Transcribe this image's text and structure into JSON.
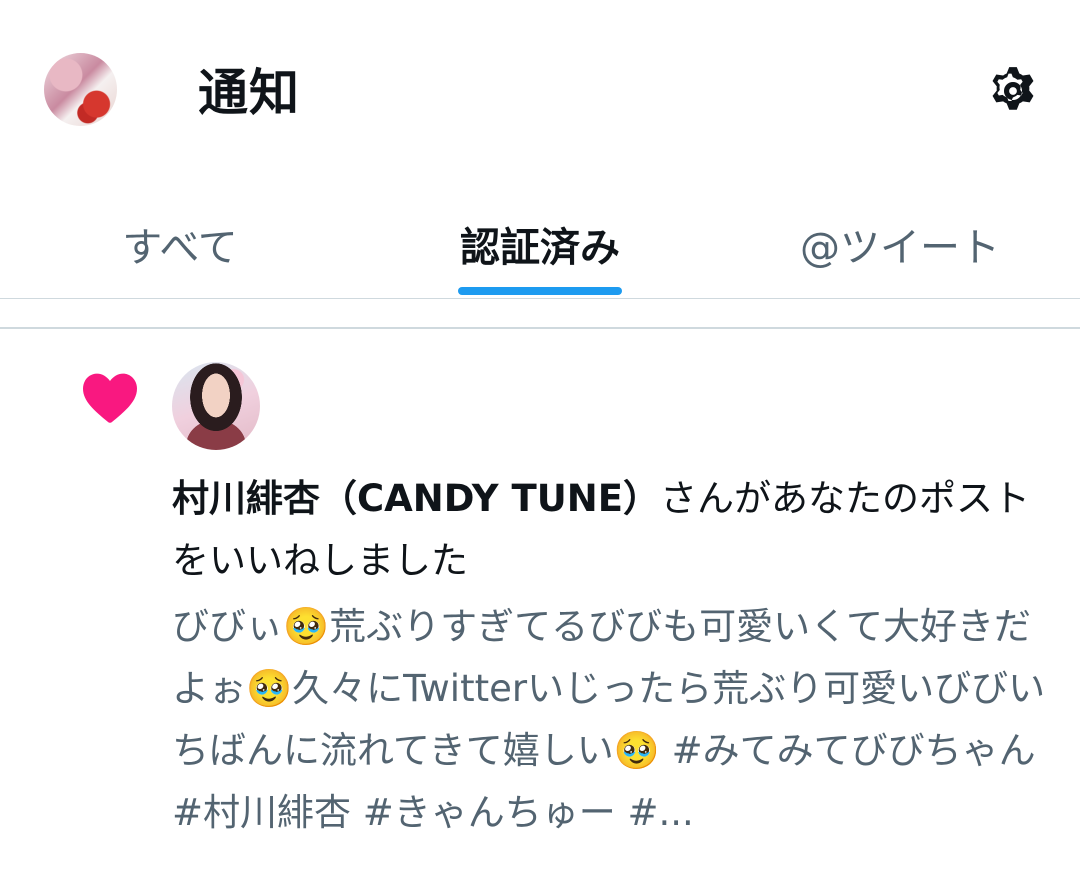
{
  "header": {
    "title": "通知",
    "avatar_icon": "profile-avatar",
    "settings_icon": "gear-icon"
  },
  "tabs": [
    {
      "label": "すべて",
      "active": false
    },
    {
      "label": "認証済み",
      "active": true
    },
    {
      "label": "@ツイート",
      "active": false
    }
  ],
  "colors": {
    "accent": "#1d9bf0",
    "like": "#f91880",
    "secondary_text": "#536471"
  },
  "notification": {
    "type_icon": "heart-icon",
    "user_name": "村川緋杏（CANDY TUNE）",
    "action_text": "さんがあなたのポストをいいねしました",
    "tweet_text": "びびぃ🥹荒ぶりすぎてるびびも可愛いくて大好きだよぉ🥹久々にTwitterいじったら荒ぶり可愛いびびいちばんに流れてきて嬉しい🥹 #みてみてびびちゃん #村川緋杏 #きゃんちゅー #..."
  }
}
